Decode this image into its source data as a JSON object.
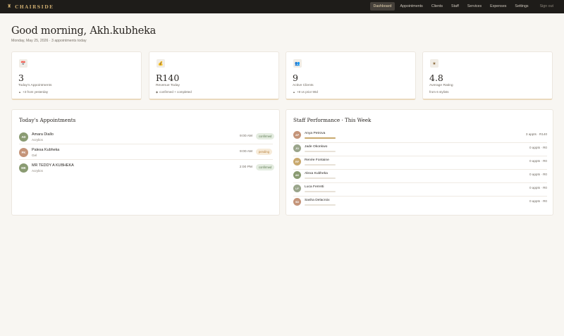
{
  "brand": {
    "name": "CHAIRSIDE",
    "icon": "chair-icon"
  },
  "nav": {
    "items": [
      {
        "label": "Dashboard",
        "active": true
      },
      {
        "label": "Appointments",
        "active": false
      },
      {
        "label": "Clients",
        "active": false
      },
      {
        "label": "Staff",
        "active": false
      },
      {
        "label": "Services",
        "active": false
      },
      {
        "label": "Expenses",
        "active": false
      },
      {
        "label": "Settings",
        "active": false
      }
    ],
    "signout": "Sign out"
  },
  "header": {
    "greeting": "Good morning, Akh.kubheka",
    "subline": "Monday, May 25, 2026 · 3 appointments today"
  },
  "stats": [
    {
      "icon": "calendar-icon",
      "glyph": "📅",
      "value": "3",
      "label": "Today's Appointments",
      "sub": "+3 from yesterday"
    },
    {
      "icon": "money-bag-icon",
      "glyph": "💰",
      "value": "R140",
      "label": "Revenue Today",
      "sub": "confirmed + completed"
    },
    {
      "icon": "people-icon",
      "glyph": "👥",
      "value": "9",
      "label": "Active Clients",
      "sub": "+8 vs prior 90d"
    },
    {
      "icon": "star-icon",
      "glyph": "★",
      "value": "4.8",
      "label": "Average Rating",
      "sub": "from 6 stylists"
    }
  ],
  "appointments": {
    "title": "Today's Appointments",
    "items": [
      {
        "initials": "AD",
        "color": "#8a9b72",
        "name": "Amara Diallo",
        "service": "Acrylics",
        "time": "9:00 AM",
        "status": "confirmed"
      },
      {
        "initials": "PK",
        "color": "#c49479",
        "name": "Palesa Kubheka",
        "service": "Gel",
        "time": "9:00 AM",
        "status": "pending"
      },
      {
        "initials": "MK",
        "color": "#8a9b72",
        "name": "MR TEDDY A KUBHEKA",
        "service": "Acrylics",
        "time": "2:00 PM",
        "status": "confirmed"
      }
    ]
  },
  "staff_performance": {
    "title": "Staff Performance · This Week",
    "items": [
      {
        "initials": "AP",
        "color": "#c49479",
        "name": "Anya Petrova",
        "stats": "3 appts · R140",
        "fill": 1.0
      },
      {
        "initials": "JO",
        "color": "#9aa58b",
        "name": "Jade Okonkwo",
        "stats": "0 appts · R0",
        "fill": 0
      },
      {
        "initials": "RF",
        "color": "#c9a96e",
        "name": "Renée Fontaine",
        "stats": "0 appts · R0",
        "fill": 0
      },
      {
        "initials": "AK",
        "color": "#8a9b72",
        "name": "Alexa Kubheka",
        "stats": "0 appts · R0",
        "fill": 0
      },
      {
        "initials": "LF",
        "color": "#9aa58b",
        "name": "Luca Ferretti",
        "stats": "0 appts · R0",
        "fill": 0
      },
      {
        "initials": "SD",
        "color": "#c49479",
        "name": "Sasha Delacroix",
        "stats": "0 appts · R0",
        "fill": 0
      }
    ]
  }
}
